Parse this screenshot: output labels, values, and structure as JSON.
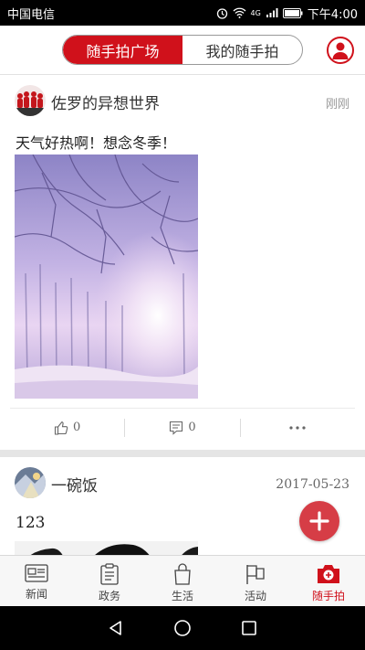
{
  "status_bar": {
    "carrier": "中国电信",
    "network": "4G",
    "time": "下午4:00"
  },
  "header": {
    "tabs": [
      {
        "label": "随手拍广场",
        "active": true
      },
      {
        "label": "我的随手拍",
        "active": false
      }
    ],
    "profile_icon": "user-icon"
  },
  "feed": {
    "posts": [
      {
        "author": "佐罗的异想世界",
        "time": "刚刚",
        "text": "天气好热啊！想念冬季！",
        "likes": "0",
        "comments": "0"
      },
      {
        "author": "一碗饭",
        "time": "2017-05-23",
        "text": "123"
      }
    ]
  },
  "fab": {
    "icon": "plus-icon"
  },
  "tab_bar": {
    "items": [
      {
        "label": "新闻",
        "icon": "news-icon"
      },
      {
        "label": "政务",
        "icon": "clipboard-icon"
      },
      {
        "label": "生活",
        "icon": "shopping-bag-icon"
      },
      {
        "label": "活动",
        "icon": "flag-icon"
      },
      {
        "label": "随手拍",
        "icon": "camera-icon",
        "active": true
      }
    ]
  },
  "colors": {
    "accent": "#d0111b",
    "fab": "#d63d46"
  }
}
